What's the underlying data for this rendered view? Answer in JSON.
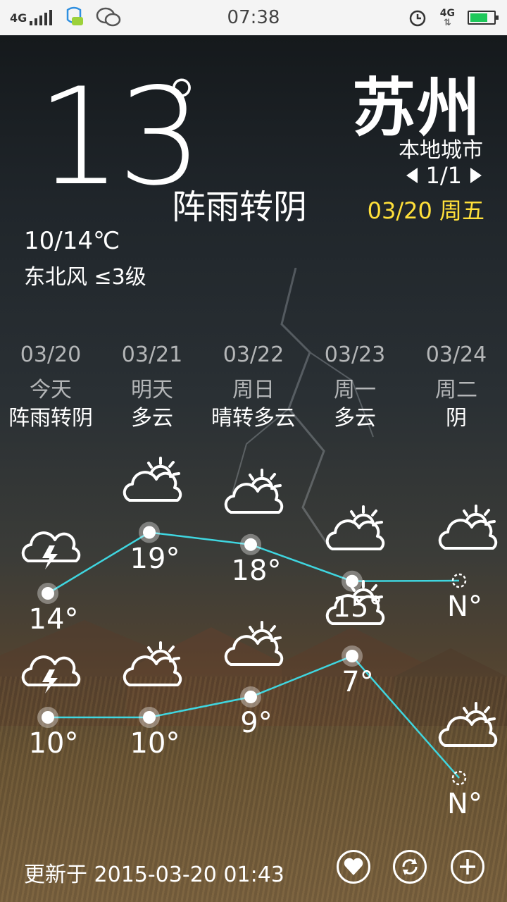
{
  "statusbar": {
    "network": "4G",
    "time": "07:38",
    "data_indicator": "4G",
    "icons": [
      "signal-icon",
      "qq-chat-icon",
      "wechat-icon",
      "alarm-icon",
      "data-arrows-icon",
      "battery-icon"
    ]
  },
  "current": {
    "temperature": "13",
    "degree_symbol": "°",
    "condition": "阵雨转阴",
    "range": "10/14℃",
    "wind": "东北风 ≤3级"
  },
  "location": {
    "city": "苏州",
    "label": "本地城市",
    "page": "1/1",
    "date": "03/20 周五"
  },
  "forecast": [
    {
      "date": "03/20",
      "day": "今天",
      "desc": "阵雨转阴",
      "high": "14°",
      "low": "10°",
      "icon_high": "thunderstorm-icon",
      "icon_low": "thunderstorm-icon"
    },
    {
      "date": "03/21",
      "day": "明天",
      "desc": "多云",
      "high": "19°",
      "low": "10°",
      "icon_high": "partly-cloudy-icon",
      "icon_low": "partly-cloudy-icon"
    },
    {
      "date": "03/22",
      "day": "周日",
      "desc": "晴转多云",
      "high": "18°",
      "low": "9°",
      "icon_high": "partly-cloudy-icon",
      "icon_low": "partly-cloudy-icon"
    },
    {
      "date": "03/23",
      "day": "周一",
      "desc": "多云",
      "high": "15°",
      "low": "7°",
      "icon_high": "partly-cloudy-icon",
      "icon_low": "partly-cloudy-icon"
    },
    {
      "date": "03/24",
      "day": "周二",
      "desc": "阴",
      "high": "N°",
      "low": "N°",
      "icon_high": "partly-cloudy-icon",
      "icon_low": "partly-cloudy-icon"
    }
  ],
  "chart_data": {
    "type": "line",
    "categories": [
      "03/20",
      "03/21",
      "03/22",
      "03/23",
      "03/24"
    ],
    "series": [
      {
        "values": [
          14,
          19,
          18,
          15,
          null
        ]
      },
      {
        "values": [
          10,
          10,
          9,
          7,
          null
        ]
      }
    ]
  },
  "footer": {
    "updated": "更新于 2015-03-20 01:43",
    "buttons": [
      "favorite-button",
      "refresh-button",
      "add-city-button"
    ]
  },
  "colors": {
    "line": "#3fd6e0",
    "date_accent": "#ffe03a",
    "background": "#20262b"
  }
}
